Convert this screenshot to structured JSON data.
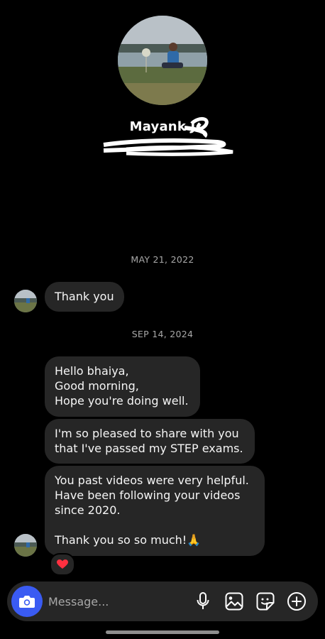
{
  "profile": {
    "name": "Mayank J"
  },
  "conversation": {
    "sections": [
      {
        "date": "MAY 21, 2022",
        "messages": [
          {
            "text": "Thank you"
          }
        ]
      },
      {
        "date": "SEP 14, 2024",
        "messages": [
          {
            "text": "Hello bhaiya,\nGood morning,\nHope you're doing well."
          },
          {
            "text": "I'm so pleased to share with you\nthat I've passed my STEP exams."
          },
          {
            "text": "You past videos were very helpful.\nHave been following your videos\nsince 2020.\n\nThank you so so much!🙏"
          }
        ],
        "reaction": "❤️"
      }
    ]
  },
  "composer": {
    "placeholder": "Message..."
  },
  "colors": {
    "background": "#000000",
    "bubble": "#262626",
    "camera_button": "#3a5bf2",
    "date_text": "#a8a8a8"
  },
  "icons": {
    "camera": "camera-icon",
    "microphone": "microphone-icon",
    "gallery": "gallery-icon",
    "sticker": "sticker-icon",
    "add": "plus-circle-icon",
    "reaction": "heart-icon"
  }
}
